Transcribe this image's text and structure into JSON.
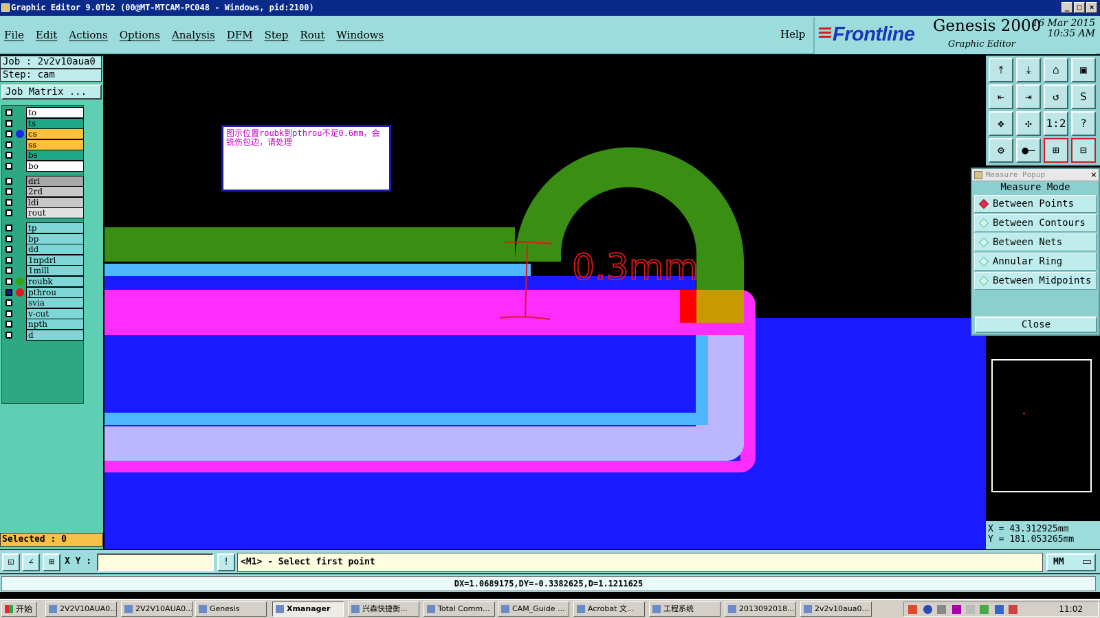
{
  "window": {
    "title": "Graphic Editor 9.0Tb2 (00@MT-MTCAM-PC048 - Windows, pid:2100)"
  },
  "menu": {
    "items": [
      "File",
      "Edit",
      "Actions",
      "Options",
      "Analysis",
      "DFM",
      "Step",
      "Rout",
      "Windows"
    ],
    "help": "Help"
  },
  "brand": {
    "logo": "Frontline",
    "product": "Genesis 2000",
    "subtitle": "Graphic Editor",
    "date": "16 Mar 2015",
    "time": "10:35 AM"
  },
  "job": {
    "job_label": "Job : 2v2v10aua0",
    "step_label": "Step: cam",
    "matrix_button": "Job Matrix ..."
  },
  "layers": [
    {
      "name": "to",
      "color": "#ffffff",
      "dot": "",
      "checked": false
    },
    {
      "name": "ts",
      "color": "#1fa888",
      "dot": "",
      "checked": false
    },
    {
      "name": "cs",
      "color": "#ffc03c",
      "dot": "#1a2ae8",
      "checked": false
    },
    {
      "name": "ss",
      "color": "#ffc03c",
      "dot": "",
      "checked": false
    },
    {
      "name": "bs",
      "color": "#1fa888",
      "dot": "",
      "checked": false
    },
    {
      "name": "bo",
      "color": "#ffffff",
      "dot": "",
      "checked": false
    },
    {
      "name": "drl",
      "color": "#a8a8a8",
      "dot": "",
      "checked": false
    },
    {
      "name": "2rd",
      "color": "#c8c8c8",
      "dot": "",
      "checked": false
    },
    {
      "name": "ldi",
      "color": "#c8c8c8",
      "dot": "",
      "checked": false
    },
    {
      "name": "rout",
      "color": "#e0e0e0",
      "dot": "",
      "checked": false
    },
    {
      "name": "tp",
      "color": "#7fd6d6",
      "dot": "",
      "checked": false
    },
    {
      "name": "bp",
      "color": "#7fd6d6",
      "dot": "",
      "checked": false
    },
    {
      "name": "dd",
      "color": "#7fd6d6",
      "dot": "",
      "checked": false
    },
    {
      "name": "1npdrl",
      "color": "#7fd6d6",
      "dot": "",
      "checked": false
    },
    {
      "name": "1mill",
      "color": "#7fd6d6",
      "dot": "",
      "checked": false
    },
    {
      "name": "roubk",
      "color": "#7fd6d6",
      "dot": "#3aa014",
      "checked": false
    },
    {
      "name": "pthrou",
      "color": "#7fd6d6",
      "dot": "#e01818",
      "checked": true
    },
    {
      "name": "svia",
      "color": "#7fd6d6",
      "dot": "",
      "checked": false
    },
    {
      "name": "v-cut",
      "color": "#7fd6d6",
      "dot": "",
      "checked": false
    },
    {
      "name": "npth",
      "color": "#7fd6d6",
      "dot": "",
      "checked": false
    },
    {
      "name": "d",
      "color": "#7fd6d6",
      "dot": "",
      "checked": false
    }
  ],
  "selected_label": "Selected : 0",
  "note": {
    "text": "图示位置roubk到pthrou不足0.6mm，会铣伤包边，请处理"
  },
  "annotation": {
    "text": "0.3mm",
    "color": "#e01818"
  },
  "toolbar_icons": [
    "zoom-home-icon",
    "zoom-down-icon",
    "home-view-icon",
    "window-icon",
    "pan-left-icon",
    "pan-right-icon",
    "mirror-icon",
    "snap-icon",
    "fit-all-icon",
    "fit-profile-icon",
    "scale-1-2-icon",
    "help-query-icon",
    "tools-icon",
    "measure-line-icon",
    "net-select-icon",
    "net-highlight-icon"
  ],
  "toolbar_labels": [
    "⤒",
    "⤓",
    "⌂",
    "▣",
    "⇤",
    "⇥",
    "↺",
    "S",
    "✥",
    "✣",
    "1:2",
    "?",
    "⚙",
    "●–",
    "⊞",
    "⊟"
  ],
  "measure": {
    "title": "Measure Popup",
    "heading": "Measure Mode",
    "options": [
      "Between Points",
      "Between Contours",
      "Between Nets",
      "Annular Ring",
      "Between Midpoints"
    ],
    "selected": "Between Points",
    "close": "Close"
  },
  "coords": {
    "x": "X = 43.312925mm",
    "y": "Y = 181.053265mm"
  },
  "command": {
    "xy_label": "X Y :",
    "xy_value": "",
    "prompt": "<M1> - Select first point",
    "units": "MM"
  },
  "status": {
    "distance": "DX=1.0689175,DY=-0.3382625,D=1.1211625"
  },
  "taskbar": {
    "start": "开始",
    "tasks": [
      "2V2V10AUA0...",
      "2V2V10AUA0...",
      "Genesis",
      "Xmanager",
      "兴森快捷衡...",
      "Total Comm...",
      "CAM_Guide ...",
      "Acrobat 文...",
      "工程系统",
      "2013092018...",
      "2v2v10aua0..."
    ],
    "active": "Xmanager",
    "clock": "11:02"
  },
  "colors": {
    "magenta": "#ff2cff",
    "blue": "#1a1aff",
    "light_blue": "#4db8ff",
    "lavender": "#bcb6ff",
    "green": "#3a8e14",
    "orange": "#c69a00",
    "red": "#ff0000"
  }
}
